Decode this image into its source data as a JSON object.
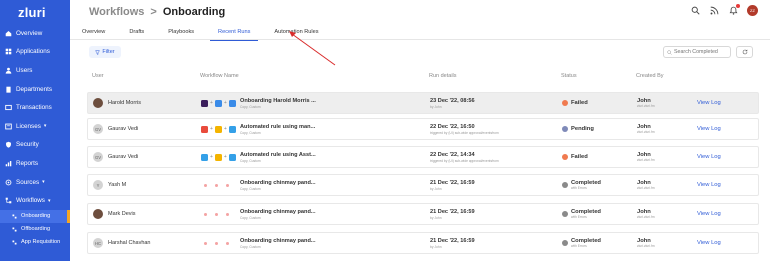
{
  "sidebar": {
    "logo": "zluri",
    "items": [
      {
        "label": "Overview",
        "icon": "home-icon"
      },
      {
        "label": "Applications",
        "icon": "grid-icon"
      },
      {
        "label": "Users",
        "icon": "users-icon"
      },
      {
        "label": "Departments",
        "icon": "building-icon"
      },
      {
        "label": "Transactions",
        "icon": "transactions-icon"
      },
      {
        "label": "Licenses",
        "icon": "license-icon"
      },
      {
        "label": "Security",
        "icon": "shield-icon"
      },
      {
        "label": "Reports",
        "icon": "report-icon"
      },
      {
        "label": "Sources",
        "icon": "sources-icon"
      },
      {
        "label": "Workflows",
        "icon": "workflow-icon"
      }
    ],
    "sub_items": [
      {
        "label": "Onboarding"
      },
      {
        "label": "Offboarding"
      },
      {
        "label": "App Requisition"
      }
    ]
  },
  "header": {
    "root": "Workflows",
    "separator": ">",
    "current": "Onboarding",
    "avatar_initials": "ZZ"
  },
  "tabs": [
    "Overview",
    "Drafts",
    "Playbooks",
    "Recent Runs",
    "Automation Rules"
  ],
  "active_tab": "Recent Runs",
  "toolbar": {
    "filter_label": "Filter",
    "search_placeholder": "Search Completed"
  },
  "table": {
    "columns": [
      "User",
      "Workflow Name",
      "Run details",
      "Status",
      "Created By"
    ],
    "rows": [
      {
        "user": "Harold Morris",
        "initials": "",
        "workflow": "Onboarding Harold Morris ...",
        "wf_sub": "Copy, Custom",
        "date": "23 Dec '22, 08:56",
        "run_sub": "by John",
        "status": "Failed",
        "status_sub": "",
        "creator": "John",
        "creator_sub": "zluri.zluri.fm",
        "action": "View Log"
      },
      {
        "user": "Gaurav Vedi",
        "initials": "GV",
        "workflow": "Automated rule using man...",
        "wf_sub": "Copy, Custom",
        "date": "22 Dec '22, 16:50",
        "run_sub": "triggered by (UI) sub-wide approval/eventsfrom",
        "status": "Pending",
        "status_sub": "",
        "creator": "John",
        "creator_sub": "zluri.zluri.fm",
        "action": "View Log"
      },
      {
        "user": "Gaurav Vedi",
        "initials": "GV",
        "workflow": "Automated rule using Asst...",
        "wf_sub": "Copy, Custom",
        "date": "22 Dec '22, 14:34",
        "run_sub": "triggered by (UI) sub-wide approval/eventsfrom",
        "status": "Failed",
        "status_sub": "",
        "creator": "John",
        "creator_sub": "zluri.zluri.fm",
        "action": "View Log"
      },
      {
        "user": "Yash M",
        "initials": "Y",
        "workflow": "Onboarding chinmay pand...",
        "wf_sub": "Copy, Custom",
        "date": "21 Dec '22, 16:59",
        "run_sub": "by John",
        "status": "Completed",
        "status_sub": "with Errors",
        "creator": "John",
        "creator_sub": "zluri.zluri.fm",
        "action": "View Log"
      },
      {
        "user": "Mark Devis",
        "initials": "",
        "workflow": "Onboarding chinmay pand...",
        "wf_sub": "Copy, Custom",
        "date": "21 Dec '22, 16:59",
        "run_sub": "by John",
        "status": "Completed",
        "status_sub": "with Errors",
        "creator": "John",
        "creator_sub": "zluri.zluri.fm",
        "action": "View Log"
      },
      {
        "user": "Harshal Chavhan",
        "initials": "HC",
        "workflow": "Onboarding chinmay pand...",
        "wf_sub": "Copy, Custom",
        "date": "21 Dec '22, 16:59",
        "run_sub": "by John",
        "status": "Completed",
        "status_sub": "with Errors",
        "creator": "John",
        "creator_sub": "zluri.zluri.fm",
        "action": "View Log"
      }
    ]
  },
  "colors": {
    "sidebar_bg": "#2f5bd6",
    "accent": "#2f5bd6",
    "failed": "#f07a4f",
    "pending": "#7f8ab8",
    "completed": "#8a8a8a",
    "annotation": "#d92a2a"
  }
}
